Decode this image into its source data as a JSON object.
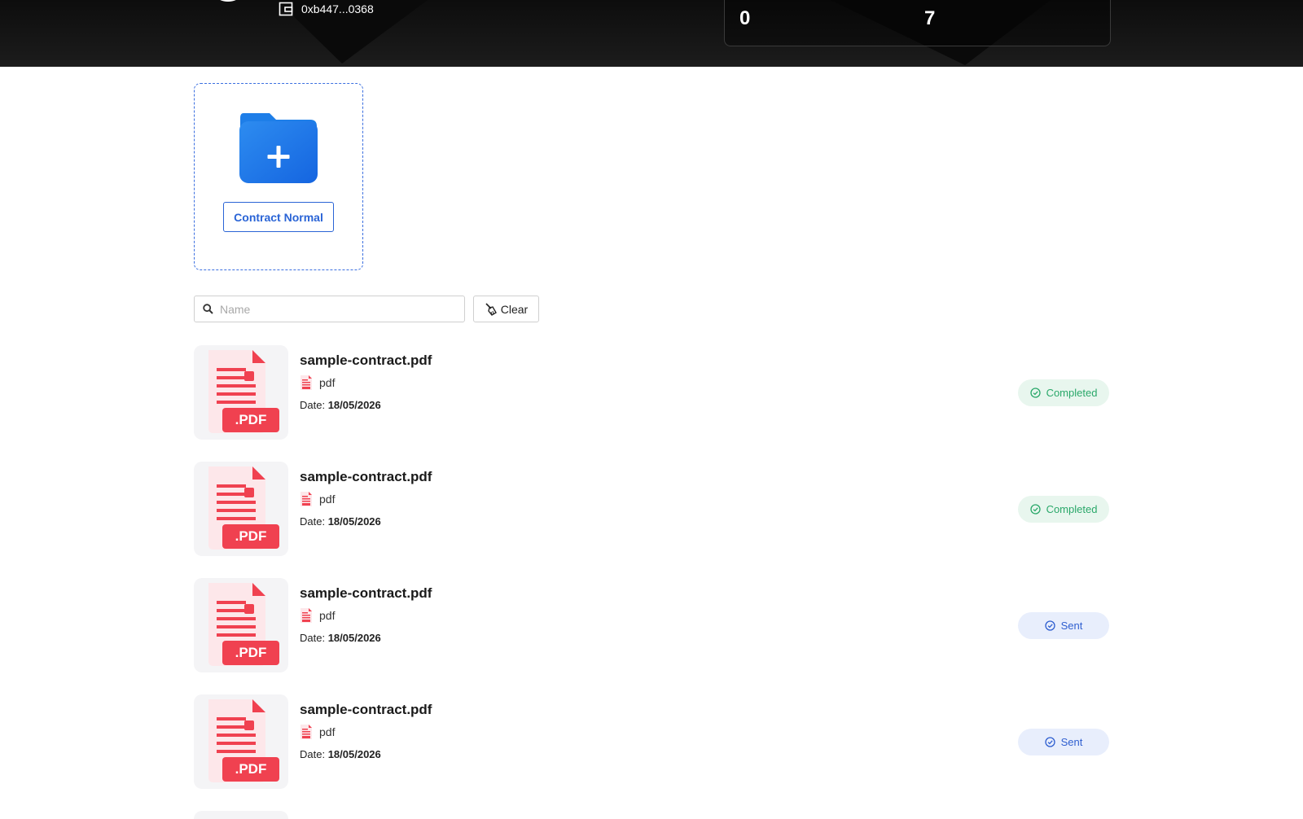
{
  "header": {
    "wallet_address": "0xb447...0368",
    "stats": [
      {
        "value": "0"
      },
      {
        "value": "7"
      }
    ]
  },
  "upload": {
    "button_label": "Contract Normal"
  },
  "search": {
    "placeholder": "Name",
    "clear_label": "Clear"
  },
  "files": [
    {
      "name": "sample-contract.pdf",
      "type": "pdf",
      "date_label": "Date:",
      "date": "18/05/2026",
      "status": "Completed",
      "thumb_label": ".PDF"
    },
    {
      "name": "sample-contract.pdf",
      "type": "pdf",
      "date_label": "Date:",
      "date": "18/05/2026",
      "status": "Completed",
      "thumb_label": ".PDF"
    },
    {
      "name": "sample-contract.pdf",
      "type": "pdf",
      "date_label": "Date:",
      "date": "18/05/2026",
      "status": "Sent",
      "thumb_label": ".PDF"
    },
    {
      "name": "sample-contract.pdf",
      "type": "pdf",
      "date_label": "Date:",
      "date": "18/05/2026",
      "status": "Sent",
      "thumb_label": ".PDF"
    }
  ],
  "colors": {
    "header_bg": "#141414",
    "accent": "#2a64d6",
    "completed": "#2aa86a",
    "sent": "#2f5fd0",
    "pdf_red": "#f04150"
  }
}
